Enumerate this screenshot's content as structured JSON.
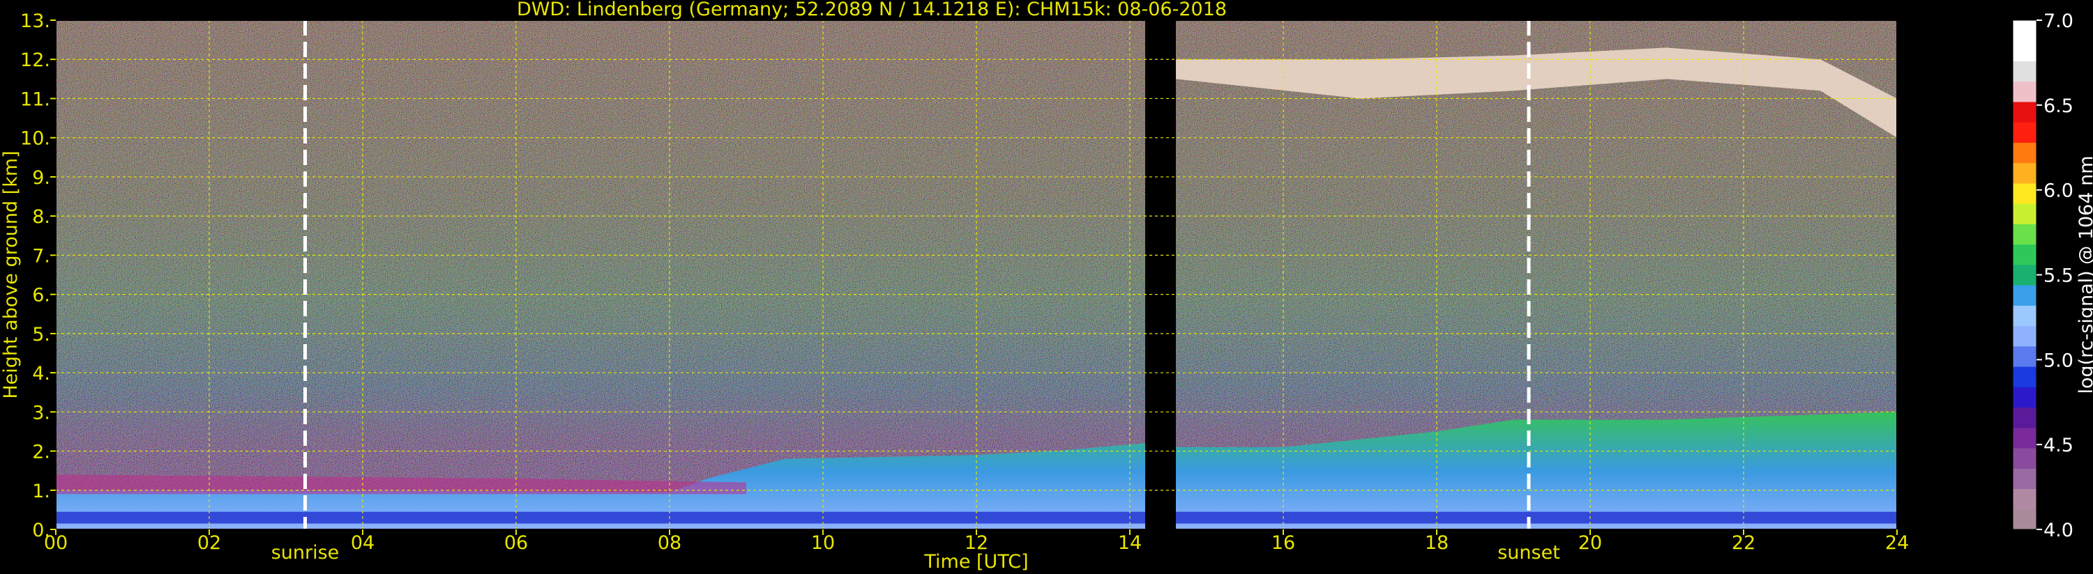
{
  "chart_data": {
    "type": "heatmap",
    "title": "DWD: Lindenberg (Germany; 52.2089 N / 14.1218 E):    CHM15k: 08-06-2018",
    "xlabel": "Time [UTC]",
    "ylabel": "Height above ground [km]",
    "xlim": [
      0,
      24
    ],
    "ylim": [
      0,
      13
    ],
    "x_ticks": [
      "00",
      "02",
      "04",
      "06",
      "08",
      "10",
      "12",
      "14",
      "16",
      "18",
      "20",
      "22",
      "24"
    ],
    "y_ticks": [
      "0.",
      "1.",
      "2.",
      "3.",
      "4.",
      "5.",
      "6.",
      "7.",
      "8.",
      "9.",
      "10.",
      "11.",
      "12.",
      "13."
    ],
    "grid": true,
    "colorbar": {
      "label": "log(rc-signal) @ 1064 nm",
      "range": [
        4.0,
        7.0
      ],
      "ticks": [
        "4.0",
        "4.5",
        "5.0",
        "5.5",
        "6.0",
        "6.5",
        "7.0"
      ]
    },
    "markers": [
      {
        "label": "sunrise",
        "x": 3.25
      },
      {
        "label": "sunset",
        "x": 19.2
      }
    ],
    "data_gap": [
      14.2,
      14.6
    ],
    "features": {
      "boundary_layer_top_km": [
        [
          0,
          1.0
        ],
        [
          4,
          1.0
        ],
        [
          8,
          0.95
        ],
        [
          8.5,
          1.3
        ],
        [
          9.5,
          1.8
        ],
        [
          12,
          1.9
        ],
        [
          13,
          2.0
        ],
        [
          14.2,
          2.2
        ],
        [
          14.6,
          2.1
        ],
        [
          16,
          2.1
        ],
        [
          18,
          2.5
        ],
        [
          19,
          2.8
        ],
        [
          21,
          2.8
        ],
        [
          24,
          3.0
        ]
      ],
      "residual_layer_top_km": [
        [
          0,
          1.4
        ],
        [
          6,
          1.3
        ],
        [
          9,
          1.2
        ]
      ],
      "cirrus_cloud_km": [
        [
          14.6,
          11.5,
          12.0
        ],
        [
          17,
          11.0,
          12.0
        ],
        [
          19,
          11.2,
          12.1
        ],
        [
          21,
          11.5,
          12.3
        ],
        [
          23,
          11.2,
          12.0
        ],
        [
          24,
          10.0,
          11.0
        ]
      ]
    }
  }
}
